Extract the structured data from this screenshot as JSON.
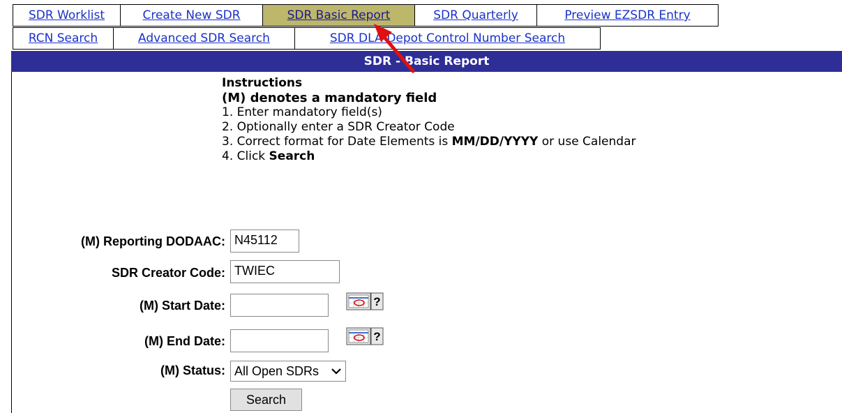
{
  "tabs_row1": [
    {
      "label": "SDR Worklist"
    },
    {
      "label": "Create New SDR"
    },
    {
      "label": "SDR Basic Report"
    },
    {
      "label": "SDR Quarterly"
    },
    {
      "label": "Preview EZSDR Entry"
    }
  ],
  "tabs_row2": [
    {
      "label": "RCN Search"
    },
    {
      "label": "Advanced SDR Search"
    },
    {
      "label": "SDR DLA-Depot Control Number Search"
    }
  ],
  "active_tab": "SDR Basic Report",
  "page_title": "SDR - Basic Report",
  "instructions": {
    "heading": "Instructions",
    "subheading": "(M) denotes a mandatory field",
    "step1": "1. Enter mandatory field(s)",
    "step2": "2. Optionally enter a SDR Creator Code",
    "step3_prefix": "3. Correct format for Date Elements is ",
    "step3_format": "MM/DD/YYYY",
    "step3_suffix": " or use Calendar",
    "step4_prefix": "4. Click ",
    "step4_bold": "Search"
  },
  "form": {
    "dodaac_label": "(M) Reporting DODAAC:",
    "dodaac_value": "N45112",
    "creator_label": "SDR Creator Code:",
    "creator_value": "TWIEC",
    "start_label": "(M) Start Date:",
    "start_value": "",
    "end_label": "(M) End Date:",
    "end_value": "",
    "status_label": "(M) Status:",
    "status_value": "All Open SDRs",
    "search_button": "Search"
  },
  "colors": {
    "title_bar": "#2e2e96",
    "active_tab": "#bdb76b",
    "link": "#1a32c8",
    "annotation_arrow": "#e01010"
  },
  "icons": {
    "calendar": "calendar-icon",
    "help": "help-icon",
    "dropdown": "chevron-down-icon"
  }
}
